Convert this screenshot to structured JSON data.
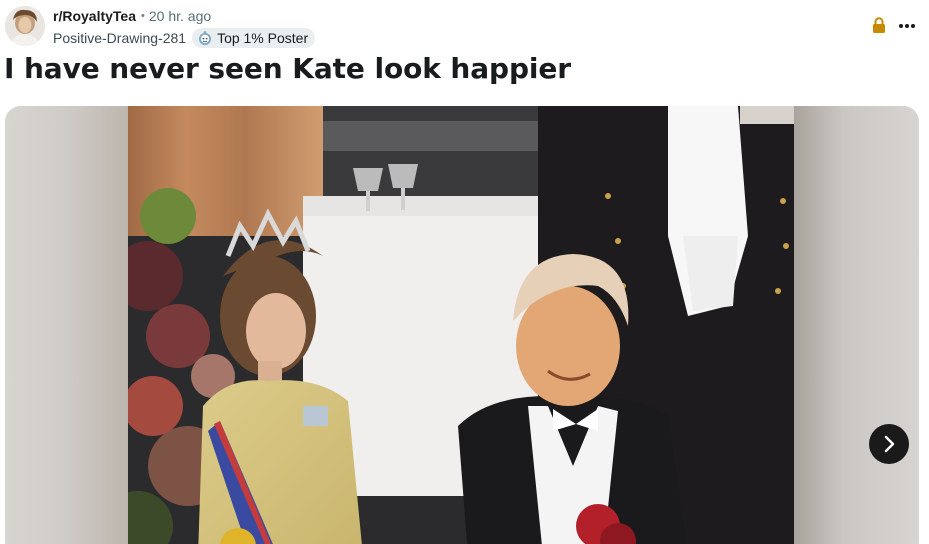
{
  "post": {
    "subreddit": "r/RoyaltyTea",
    "separator": "•",
    "time_ago": "20 hr. ago",
    "author": "Positive-Drawing-281",
    "author_flair": "Top 1% Poster",
    "title": "I have never seen Kate look happier"
  },
  "icons": {
    "lock": "lock-icon",
    "more": "more-options-icon",
    "flair": "snoo-badge-icon",
    "next": "chevron-right-icon"
  },
  "colors": {
    "lock": "#c78a00",
    "carousel_button": "#1a1a1b",
    "flair_bg": "#e9eef1"
  }
}
